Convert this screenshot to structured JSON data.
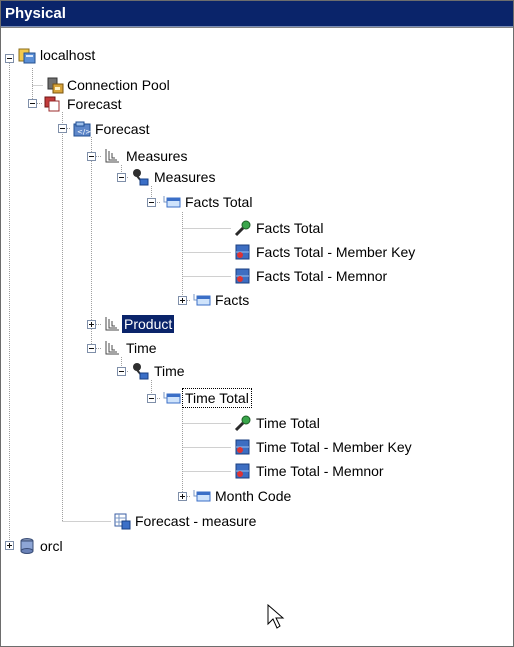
{
  "panel": {
    "title": "Physical"
  },
  "tree": {
    "localhost": "localhost",
    "connection_pool": "Connection Pool",
    "forecast_catalog": "Forecast",
    "forecast_schema": "Forecast",
    "measures_dim": "Measures",
    "measures_hier": "Measures",
    "facts_total_level": "Facts Total",
    "facts_total_col": "Facts Total",
    "facts_total_member_key": "Facts Total - Member Key",
    "facts_total_memnor": "Facts Total - Memnor",
    "facts_level": "Facts",
    "product_dim": "Product",
    "time_dim": "Time",
    "time_hier": "Time",
    "time_total_level": "Time Total",
    "time_total_col": "Time Total",
    "time_total_member_key": "Time Total - Member Key",
    "time_total_memnor": "Time Total - Memnor",
    "month_code_level": "Month Code",
    "forecast_measure": "Forecast - measure",
    "orcl": "orcl"
  },
  "colors": {
    "title_bar": "#0a246a",
    "selection": "#0a246a",
    "tree_line": "#a0a0a0"
  }
}
